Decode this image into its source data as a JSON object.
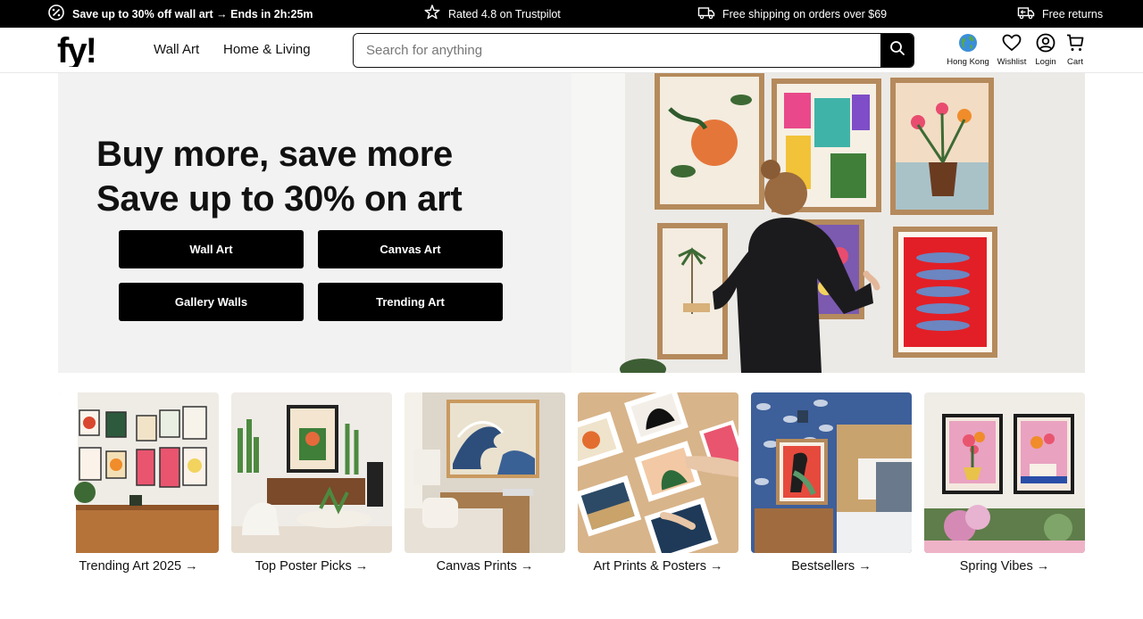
{
  "promo": {
    "sale": "Save up to 30% off wall art → Ends in 2h:25m",
    "rated": "Rated 4.8 on Trustpilot",
    "shipping": "Free shipping on orders over $69",
    "returns": "Free returns"
  },
  "header": {
    "logo_text": "fy!",
    "nav": {
      "wall_art": "Wall Art",
      "home_living": "Home & Living"
    },
    "search_placeholder": "Search for anything",
    "utils": {
      "region": "Hong Kong",
      "wishlist": "Wishlist",
      "login": "Login",
      "cart": "Cart"
    }
  },
  "hero": {
    "title_line1": "Buy more, save more",
    "title_line2": "Save up to 30% on art",
    "buttons": [
      "Wall Art",
      "Canvas Art",
      "Gallery Walls",
      "Trending Art"
    ]
  },
  "categories": [
    {
      "label": "Trending Art 2025 →"
    },
    {
      "label": "Top Poster Picks →"
    },
    {
      "label": "Canvas Prints →"
    },
    {
      "label": "Art Prints & Posters →"
    },
    {
      "label": "Bestsellers →"
    },
    {
      "label": "Spring Vibes →"
    }
  ],
  "colors": {
    "promo_bg": "#000000",
    "hero_bg": "#f2f2f2",
    "button_bg": "#000000"
  }
}
